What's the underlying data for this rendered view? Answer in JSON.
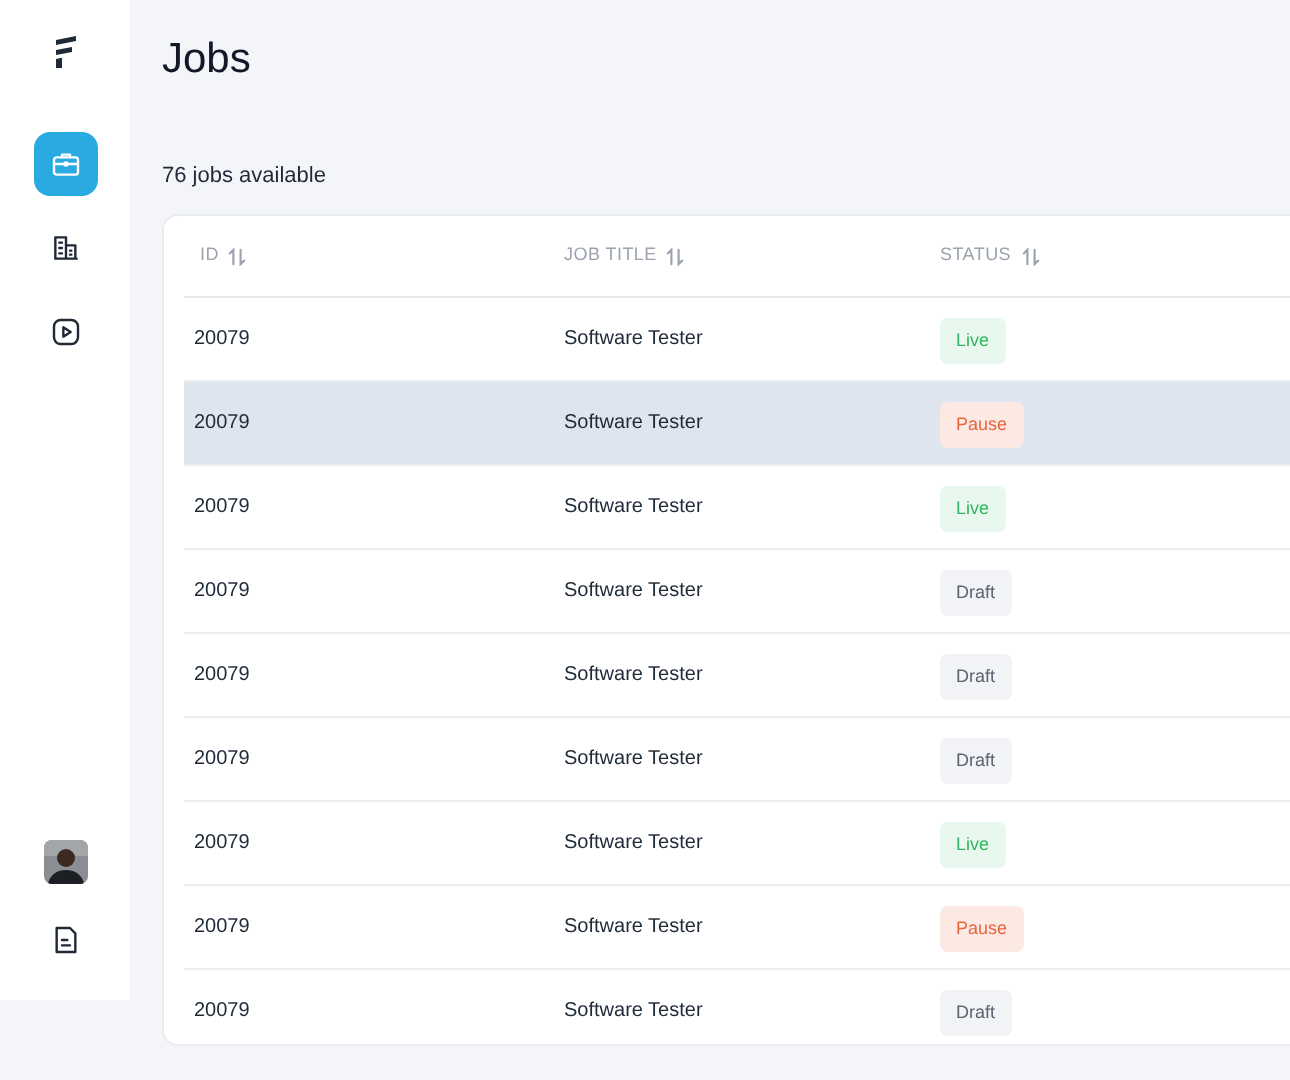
{
  "sidebar": {
    "items": [
      {
        "kind": "briefcase",
        "selected": true
      },
      {
        "kind": "buildings",
        "selected": false
      },
      {
        "kind": "play",
        "selected": false
      }
    ],
    "bottom": [
      {
        "kind": "avatar"
      },
      {
        "kind": "document"
      }
    ]
  },
  "title": "Jobs",
  "count": "76 jobs available",
  "table": {
    "columns": [
      "ID",
      "JOB TITLE",
      "STATUS"
    ],
    "rows": [
      {
        "id": "20079",
        "title": "Software Tester",
        "status": "Live",
        "kind": "live",
        "selected": false
      },
      {
        "id": "20079",
        "title": "Software Tester",
        "status": "Pause",
        "kind": "pause",
        "selected": true
      },
      {
        "id": "20079",
        "title": "Software Tester",
        "status": "Live",
        "kind": "live",
        "selected": false
      },
      {
        "id": "20079",
        "title": "Software Tester",
        "status": "Draft",
        "kind": "draft",
        "selected": false
      },
      {
        "id": "20079",
        "title": "Software Tester",
        "status": "Draft",
        "kind": "draft",
        "selected": false
      },
      {
        "id": "20079",
        "title": "Software Tester",
        "status": "Draft",
        "kind": "draft",
        "selected": false
      },
      {
        "id": "20079",
        "title": "Software Tester",
        "status": "Live",
        "kind": "live",
        "selected": false
      },
      {
        "id": "20079",
        "title": "Software Tester",
        "status": "Pause",
        "kind": "pause",
        "selected": false
      },
      {
        "id": "20079",
        "title": "Software Tester",
        "status": "Draft",
        "kind": "draft",
        "selected": false
      }
    ]
  }
}
